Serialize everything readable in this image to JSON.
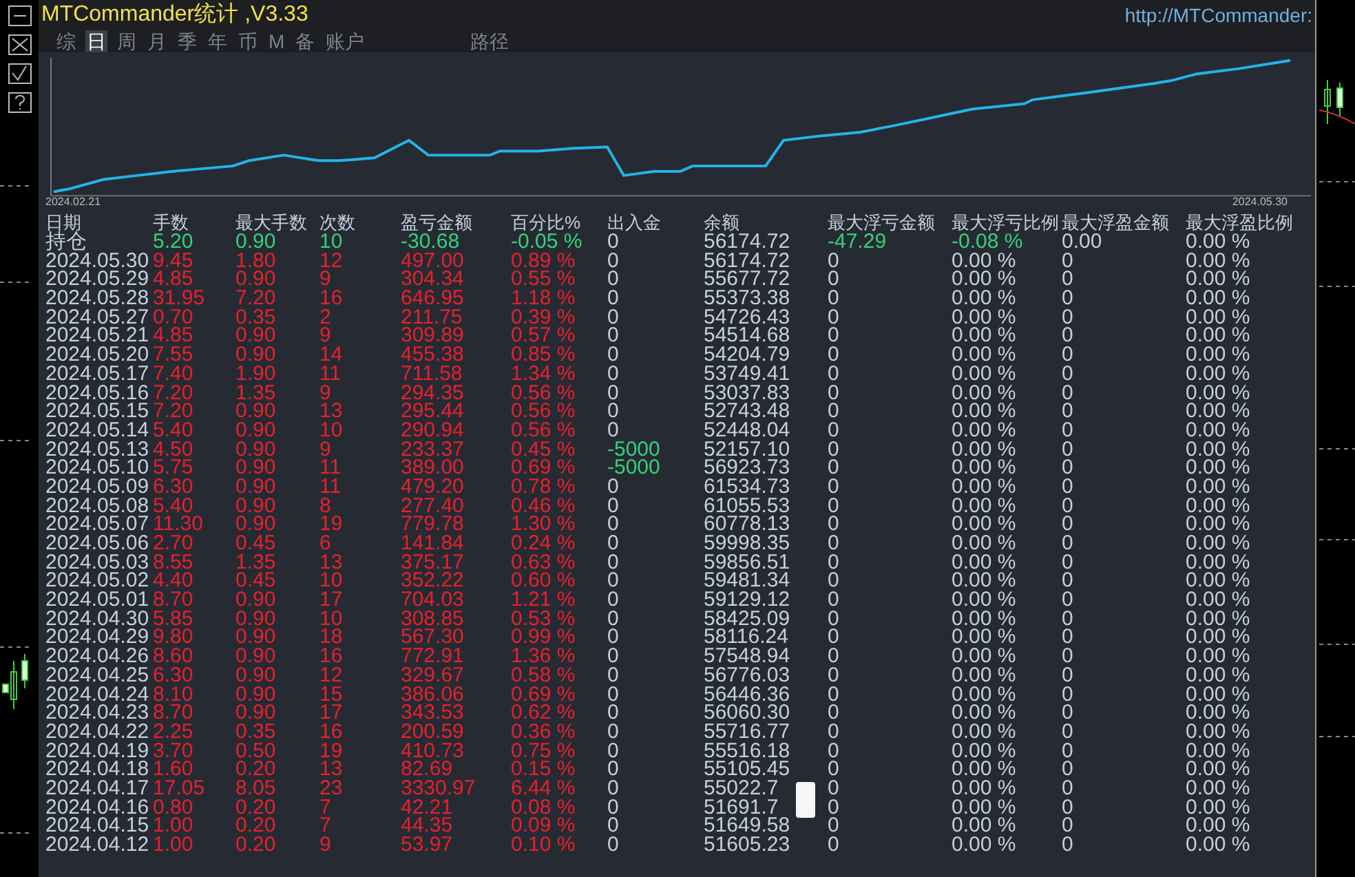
{
  "window": {
    "title": "MTCommander统计 ,V3.33",
    "url": "http://MTCommander:"
  },
  "tabs": [
    {
      "label": "综",
      "selected": false
    },
    {
      "label": "日",
      "selected": true
    },
    {
      "label": "周",
      "selected": false
    },
    {
      "label": "月",
      "selected": false
    },
    {
      "label": "季",
      "selected": false
    },
    {
      "label": "年",
      "selected": false
    },
    {
      "label": "币",
      "selected": false
    },
    {
      "label": "M",
      "selected": false
    },
    {
      "label": "备",
      "selected": false
    },
    {
      "label": "账户",
      "selected": false
    }
  ],
  "path_tab": {
    "label": "路径"
  },
  "equity_chart": {
    "start_label": "2024.02.21",
    "end_label": "2024.05.30"
  },
  "table": {
    "columns": [
      "日期",
      "手数",
      "最大手数",
      "次数",
      "盈亏金额",
      "百分比%",
      "出入金",
      "余额",
      "最大浮亏金额",
      "最大浮亏比例",
      "最大浮盈金额",
      "最大浮盈比例"
    ],
    "rows": [
      {
        "kind": "holding",
        "cells": [
          "持仓",
          "5.20",
          "0.90",
          "10",
          "-30.68",
          "-0.05 %",
          "0",
          "56174.72",
          "-47.29",
          "-0.08 %",
          "0.00",
          "0.00 %"
        ]
      },
      {
        "kind": "day",
        "cells": [
          "2024.05.30",
          "9.45",
          "1.80",
          "12",
          "497.00",
          "0.89 %",
          "0",
          "56174.72",
          "0",
          "0.00 %",
          "0",
          "0.00 %"
        ]
      },
      {
        "kind": "day",
        "cells": [
          "2024.05.29",
          "4.85",
          "0.90",
          "9",
          "304.34",
          "0.55 %",
          "0",
          "55677.72",
          "0",
          "0.00 %",
          "0",
          "0.00 %"
        ]
      },
      {
        "kind": "day",
        "cells": [
          "2024.05.28",
          "31.95",
          "7.20",
          "16",
          "646.95",
          "1.18 %",
          "0",
          "55373.38",
          "0",
          "0.00 %",
          "0",
          "0.00 %"
        ]
      },
      {
        "kind": "day",
        "cells": [
          "2024.05.27",
          "0.70",
          "0.35",
          "2",
          "211.75",
          "0.39 %",
          "0",
          "54726.43",
          "0",
          "0.00 %",
          "0",
          "0.00 %"
        ]
      },
      {
        "kind": "day",
        "cells": [
          "2024.05.21",
          "4.85",
          "0.90",
          "9",
          "309.89",
          "0.57 %",
          "0",
          "54514.68",
          "0",
          "0.00 %",
          "0",
          "0.00 %"
        ]
      },
      {
        "kind": "day",
        "cells": [
          "2024.05.20",
          "7.55",
          "0.90",
          "14",
          "455.38",
          "0.85 %",
          "0",
          "54204.79",
          "0",
          "0.00 %",
          "0",
          "0.00 %"
        ]
      },
      {
        "kind": "day",
        "cells": [
          "2024.05.17",
          "7.40",
          "1.90",
          "11",
          "711.58",
          "1.34 %",
          "0",
          "53749.41",
          "0",
          "0.00 %",
          "0",
          "0.00 %"
        ]
      },
      {
        "kind": "day",
        "cells": [
          "2024.05.16",
          "7.20",
          "1.35",
          "9",
          "294.35",
          "0.56 %",
          "0",
          "53037.83",
          "0",
          "0.00 %",
          "0",
          "0.00 %"
        ]
      },
      {
        "kind": "day",
        "cells": [
          "2024.05.15",
          "7.20",
          "0.90",
          "13",
          "295.44",
          "0.56 %",
          "0",
          "52743.48",
          "0",
          "0.00 %",
          "0",
          "0.00 %"
        ]
      },
      {
        "kind": "day",
        "cells": [
          "2024.05.14",
          "5.40",
          "0.90",
          "10",
          "290.94",
          "0.56 %",
          "0",
          "52448.04",
          "0",
          "0.00 %",
          "0",
          "0.00 %"
        ]
      },
      {
        "kind": "day",
        "cells": [
          "2024.05.13",
          "4.50",
          "0.90",
          "9",
          "233.37",
          "0.45 %",
          "-5000",
          "52157.10",
          "0",
          "0.00 %",
          "0",
          "0.00 %"
        ]
      },
      {
        "kind": "day",
        "cells": [
          "2024.05.10",
          "5.75",
          "0.90",
          "11",
          "389.00",
          "0.69 %",
          "-5000",
          "56923.73",
          "0",
          "0.00 %",
          "0",
          "0.00 %"
        ]
      },
      {
        "kind": "day",
        "cells": [
          "2024.05.09",
          "6.30",
          "0.90",
          "11",
          "479.20",
          "0.78 %",
          "0",
          "61534.73",
          "0",
          "0.00 %",
          "0",
          "0.00 %"
        ]
      },
      {
        "kind": "day",
        "cells": [
          "2024.05.08",
          "5.40",
          "0.90",
          "8",
          "277.40",
          "0.46 %",
          "0",
          "61055.53",
          "0",
          "0.00 %",
          "0",
          "0.00 %"
        ]
      },
      {
        "kind": "day",
        "cells": [
          "2024.05.07",
          "11.30",
          "0.90",
          "19",
          "779.78",
          "1.30 %",
          "0",
          "60778.13",
          "0",
          "0.00 %",
          "0",
          "0.00 %"
        ]
      },
      {
        "kind": "day",
        "cells": [
          "2024.05.06",
          "2.70",
          "0.45",
          "6",
          "141.84",
          "0.24 %",
          "0",
          "59998.35",
          "0",
          "0.00 %",
          "0",
          "0.00 %"
        ]
      },
      {
        "kind": "day",
        "cells": [
          "2024.05.03",
          "8.55",
          "1.35",
          "13",
          "375.17",
          "0.63 %",
          "0",
          "59856.51",
          "0",
          "0.00 %",
          "0",
          "0.00 %"
        ]
      },
      {
        "kind": "day",
        "cells": [
          "2024.05.02",
          "4.40",
          "0.45",
          "10",
          "352.22",
          "0.60 %",
          "0",
          "59481.34",
          "0",
          "0.00 %",
          "0",
          "0.00 %"
        ]
      },
      {
        "kind": "day",
        "cells": [
          "2024.05.01",
          "8.70",
          "0.90",
          "17",
          "704.03",
          "1.21 %",
          "0",
          "59129.12",
          "0",
          "0.00 %",
          "0",
          "0.00 %"
        ]
      },
      {
        "kind": "day",
        "cells": [
          "2024.04.30",
          "5.85",
          "0.90",
          "10",
          "308.85",
          "0.53 %",
          "0",
          "58425.09",
          "0",
          "0.00 %",
          "0",
          "0.00 %"
        ]
      },
      {
        "kind": "day",
        "cells": [
          "2024.04.29",
          "9.80",
          "0.90",
          "18",
          "567.30",
          "0.99 %",
          "0",
          "58116.24",
          "0",
          "0.00 %",
          "0",
          "0.00 %"
        ]
      },
      {
        "kind": "day",
        "cells": [
          "2024.04.26",
          "8.60",
          "0.90",
          "16",
          "772.91",
          "1.36 %",
          "0",
          "57548.94",
          "0",
          "0.00 %",
          "0",
          "0.00 %"
        ]
      },
      {
        "kind": "day",
        "cells": [
          "2024.04.25",
          "6.30",
          "0.90",
          "12",
          "329.67",
          "0.58 %",
          "0",
          "56776.03",
          "0",
          "0.00 %",
          "0",
          "0.00 %"
        ]
      },
      {
        "kind": "day",
        "cells": [
          "2024.04.24",
          "8.10",
          "0.90",
          "15",
          "386.06",
          "0.69 %",
          "0",
          "56446.36",
          "0",
          "0.00 %",
          "0",
          "0.00 %"
        ]
      },
      {
        "kind": "day",
        "cells": [
          "2024.04.23",
          "8.70",
          "0.90",
          "17",
          "343.53",
          "0.62 %",
          "0",
          "56060.30",
          "0",
          "0.00 %",
          "0",
          "0.00 %"
        ]
      },
      {
        "kind": "day",
        "cells": [
          "2024.04.22",
          "2.25",
          "0.35",
          "16",
          "200.59",
          "0.36 %",
          "0",
          "55716.77",
          "0",
          "0.00 %",
          "0",
          "0.00 %"
        ]
      },
      {
        "kind": "day",
        "cells": [
          "2024.04.19",
          "3.70",
          "0.50",
          "19",
          "410.73",
          "0.75 %",
          "0",
          "55516.18",
          "0",
          "0.00 %",
          "0",
          "0.00 %"
        ]
      },
      {
        "kind": "day",
        "cells": [
          "2024.04.18",
          "1.60",
          "0.20",
          "13",
          "82.69",
          "0.15 %",
          "0",
          "55105.45",
          "0",
          "0.00 %",
          "0",
          "0.00 %"
        ]
      },
      {
        "kind": "day",
        "cells": [
          "2024.04.17",
          "17.05",
          "8.05",
          "23",
          "3330.97",
          "6.44 %",
          "0",
          "55022.7",
          "0",
          "0.00 %",
          "0",
          "0.00 %"
        ]
      },
      {
        "kind": "day",
        "cells": [
          "2024.04.16",
          "0.80",
          "0.20",
          "7",
          "42.21",
          "0.08 %",
          "0",
          "51691.7",
          "0",
          "0.00 %",
          "0",
          "0.00 %"
        ]
      },
      {
        "kind": "day",
        "cells": [
          "2024.04.15",
          "1.00",
          "0.20",
          "7",
          "44.35",
          "0.09 %",
          "0",
          "51649.58",
          "0",
          "0.00 %",
          "0",
          "0.00 %"
        ]
      },
      {
        "kind": "day",
        "cells": [
          "2024.04.12",
          "1.00",
          "0.20",
          "9",
          "53.97",
          "0.10 %",
          "0",
          "51605.23",
          "0",
          "0.00 %",
          "0",
          "0.00 %"
        ]
      }
    ]
  }
}
